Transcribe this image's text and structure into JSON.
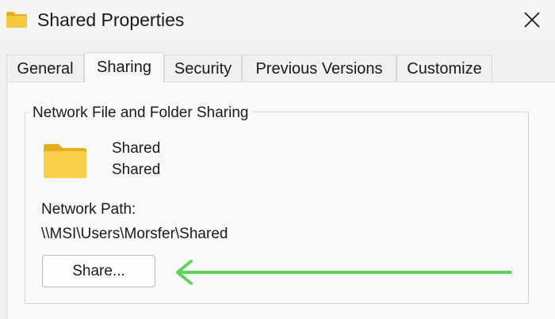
{
  "window": {
    "title": "Shared Properties",
    "close_icon": "close-icon"
  },
  "tabs": [
    {
      "label": "General",
      "active": false
    },
    {
      "label": "Sharing",
      "active": true
    },
    {
      "label": "Security",
      "active": false
    },
    {
      "label": "Previous Versions",
      "active": false
    },
    {
      "label": "Customize",
      "active": false
    }
  ],
  "sharing": {
    "group_title": "Network File and Folder Sharing",
    "folder_name": "Shared",
    "share_status": "Shared",
    "network_path_label": "Network Path:",
    "network_path_value": "\\\\MSI\\Users\\Morsfer\\Shared",
    "share_button_label": "Share..."
  },
  "colors": {
    "folder": "#f6c83e",
    "folder_dark": "#e6ad20",
    "arrow": "#5fd35a"
  }
}
